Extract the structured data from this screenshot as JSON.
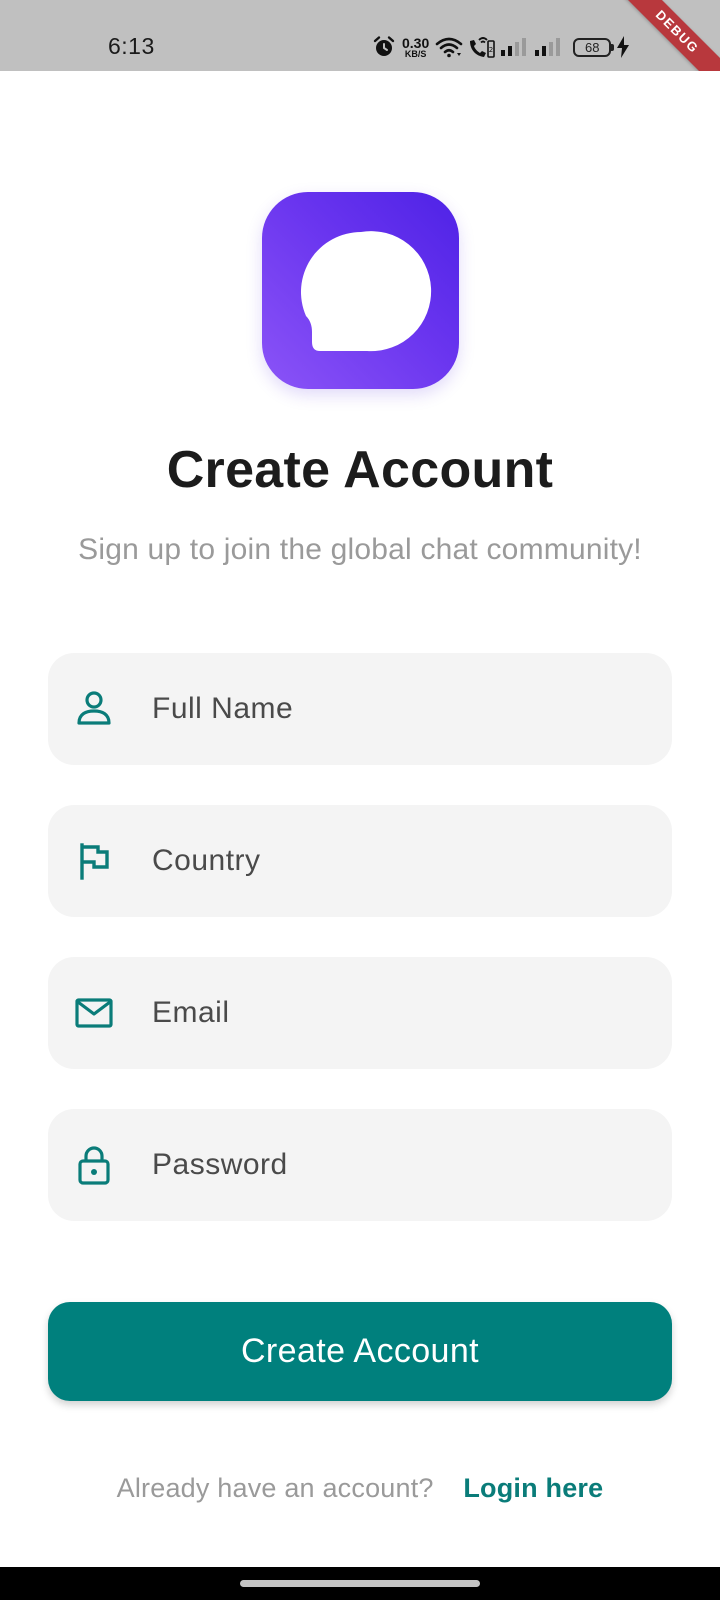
{
  "status_bar": {
    "time": "6:13",
    "net_speed_value": "0.30",
    "net_speed_unit": "KB/S",
    "battery_level": "68",
    "icons": [
      "alarm-icon",
      "wifi-icon",
      "call-wifi-icon",
      "signal-icon",
      "signal-icon",
      "battery-icon",
      "charging-icon"
    ]
  },
  "debug_banner": "DEBUG",
  "logo": {
    "icon": "chat-bubble-icon",
    "colors": {
      "gradient_start": "#8b54f7",
      "gradient_end": "#4e22e6"
    }
  },
  "header": {
    "title": "Create Account",
    "subtitle": "Sign up to join the global chat community!"
  },
  "form": {
    "fields": [
      {
        "icon": "person-icon",
        "placeholder": "Full Name",
        "value": ""
      },
      {
        "icon": "flag-icon",
        "placeholder": "Country",
        "value": ""
      },
      {
        "icon": "mail-icon",
        "placeholder": "Email",
        "value": ""
      },
      {
        "icon": "lock-icon",
        "placeholder": "Password",
        "value": ""
      }
    ],
    "submit_label": "Create Account"
  },
  "footer": {
    "prompt": "Already have an account?",
    "login_link": "Login here"
  },
  "colors": {
    "accent": "#00807d",
    "link": "#0a7c79",
    "field_background": "#f4f4f4",
    "debug_ribbon": "#b8383d"
  }
}
